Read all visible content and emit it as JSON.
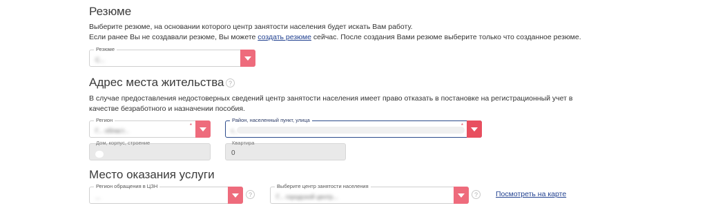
{
  "resume": {
    "title": "Резюме",
    "line1": "Выберите резюме, на основании которого центр занятости населения будет искать Вам работу.",
    "line2_before": "Если ранее Вы не создавали резюме, Вы можете ",
    "line2_link": "создать резюме",
    "line2_after": " сейчас. После создания Вами резюме выберите только что созданное резюме.",
    "select_label": "Резюме",
    "select_value": "С..."
  },
  "address": {
    "title": "Адрес места жительства",
    "note_line1": "В случае предоставления недостоверных сведений центр занятости населения имеет право отказать в постановке на регистрационный учет в",
    "note_line2": "качестве безработного и назначении пособия.",
    "region_label": "Регион",
    "region_value": "Г... област...",
    "district_label": "Район, населенный пункт, улица",
    "district_value": "г...",
    "house_label": "Дом, корпус, строение",
    "house_value": "",
    "apartment_label": "Квартира",
    "apartment_value": "0",
    "required_mark": "*"
  },
  "service": {
    "title": "Место оказания услуги",
    "region_label": "Регион обращения в ЦЗН",
    "region_value": "...",
    "center_label": "Выберите центр занятости населения",
    "center_value": "Г... городской центр...",
    "map_link": "Посмотреть на карте"
  },
  "icons": {
    "help": "?",
    "dropdown": "chevron-down-icon"
  },
  "colors": {
    "accent": "#ee6b7c",
    "link": "#1f3f8f",
    "active_border": "#2a4a8a"
  }
}
